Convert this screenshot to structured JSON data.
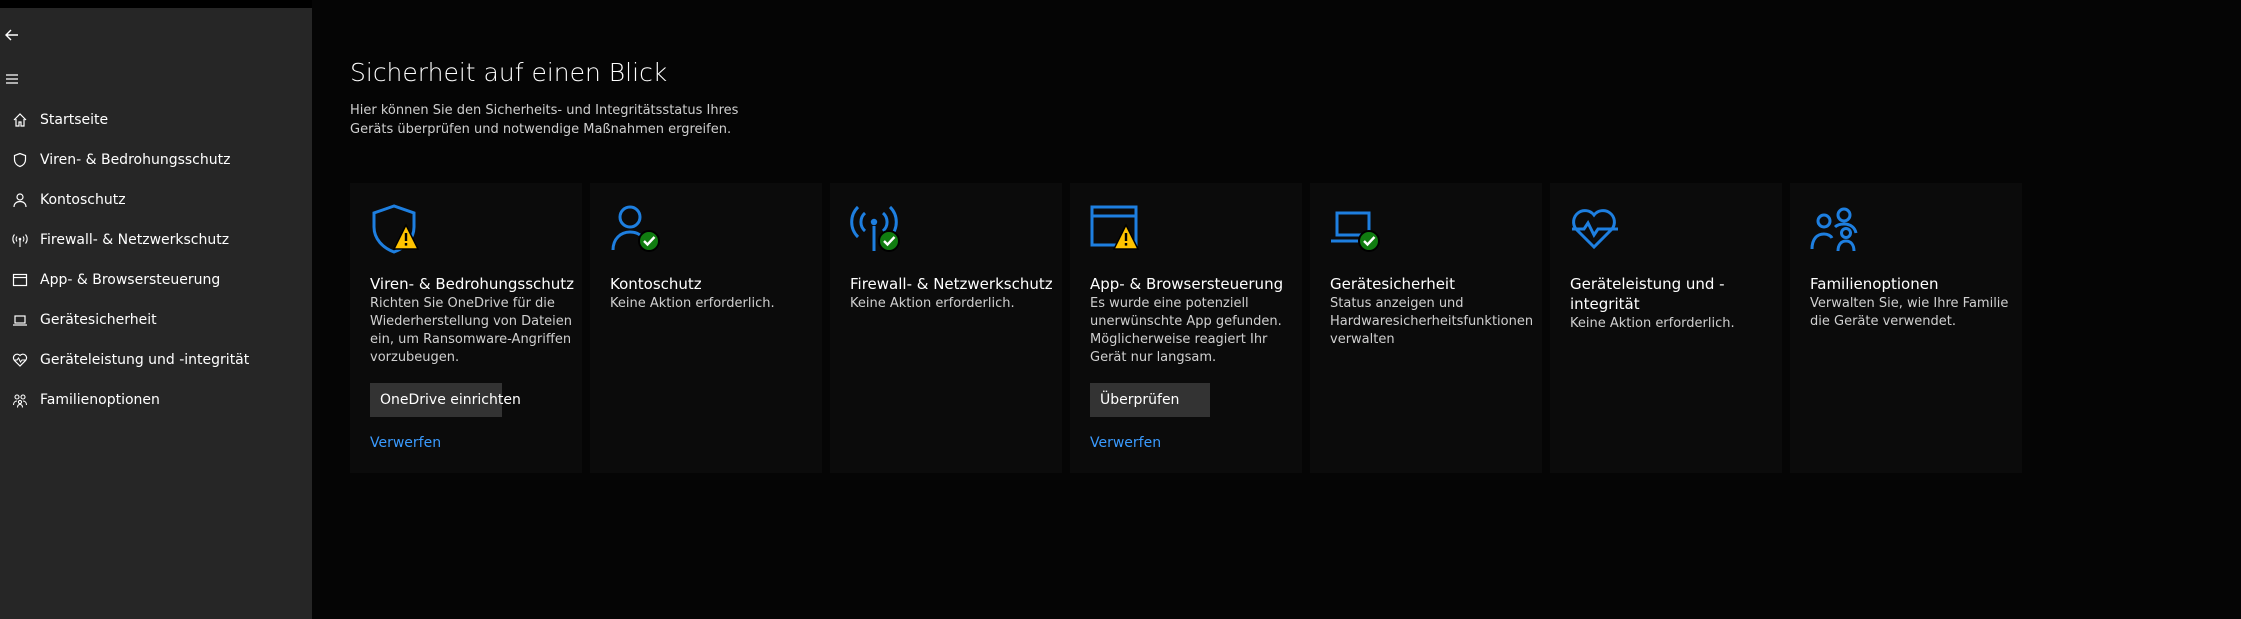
{
  "sidebar": {
    "back_icon": "arrow-left-icon",
    "menu_icon": "hamburger-icon",
    "items": [
      {
        "label": "Startseite",
        "icon": "home-icon"
      },
      {
        "label": "Viren- & Bedrohungsschutz",
        "icon": "shield-icon"
      },
      {
        "label": "Kontoschutz",
        "icon": "person-icon"
      },
      {
        "label": "Firewall- & Netzwerkschutz",
        "icon": "antenna-icon"
      },
      {
        "label": "App- & Browsersteuerung",
        "icon": "app-window-icon"
      },
      {
        "label": "Gerätesicherheit",
        "icon": "laptop-icon"
      },
      {
        "label": "Geräteleistung und -integrität",
        "icon": "heart-pulse-icon"
      },
      {
        "label": "Familienoptionen",
        "icon": "family-icon"
      }
    ]
  },
  "main": {
    "title": "Sicherheit auf einen Blick",
    "description": "Hier können Sie den Sicherheits- und Integritätsstatus Ihres Geräts überprüfen und notwendige Maßnahmen ergreifen."
  },
  "cards": [
    {
      "title": "Viren- & Bedrohungsschutz",
      "text": "Richten Sie OneDrive für die Wiederherstellung von Dateien ein, um Ransomware-Angriffen vorzubeugen.",
      "button": "OneDrive einrichten",
      "link": "Verwerfen",
      "status": "warning",
      "icon": "shield-warning-icon"
    },
    {
      "title": "Kontoschutz",
      "text": "Keine Aktion erforderlich.",
      "status": "ok",
      "icon": "person-check-icon"
    },
    {
      "title": "Firewall- & Netzwerkschutz",
      "text": "Keine Aktion erforderlich.",
      "status": "ok",
      "icon": "antenna-check-icon"
    },
    {
      "title": "App- & Browsersteuerung",
      "text": "Es wurde eine potenziell unerwünschte App gefunden. Möglicherweise reagiert Ihr Gerät nur langsam.",
      "button": "Überprüfen",
      "link": "Verwerfen",
      "status": "warning",
      "icon": "app-window-warning-icon"
    },
    {
      "title": "Gerätesicherheit",
      "text": "Status anzeigen und Hardwaresicherheitsfunktionen verwalten",
      "status": "ok",
      "icon": "laptop-check-icon"
    },
    {
      "title": "Geräteleistung und -integrität",
      "text": "Keine Aktion erforderlich.",
      "status": "ok",
      "icon": "heart-pulse-icon"
    },
    {
      "title": "Familienoptionen",
      "text": "Verwalten Sie, wie Ihre Familie die Geräte verwendet.",
      "status": "info",
      "icon": "family-icon"
    }
  ],
  "colors": {
    "sidebar_bg": "#262626",
    "main_bg": "#050505",
    "accent_blue": "#1e7fe0",
    "link_blue": "#3a9bff",
    "ok_green": "#107c10",
    "warning_yellow": "#ffc300"
  }
}
